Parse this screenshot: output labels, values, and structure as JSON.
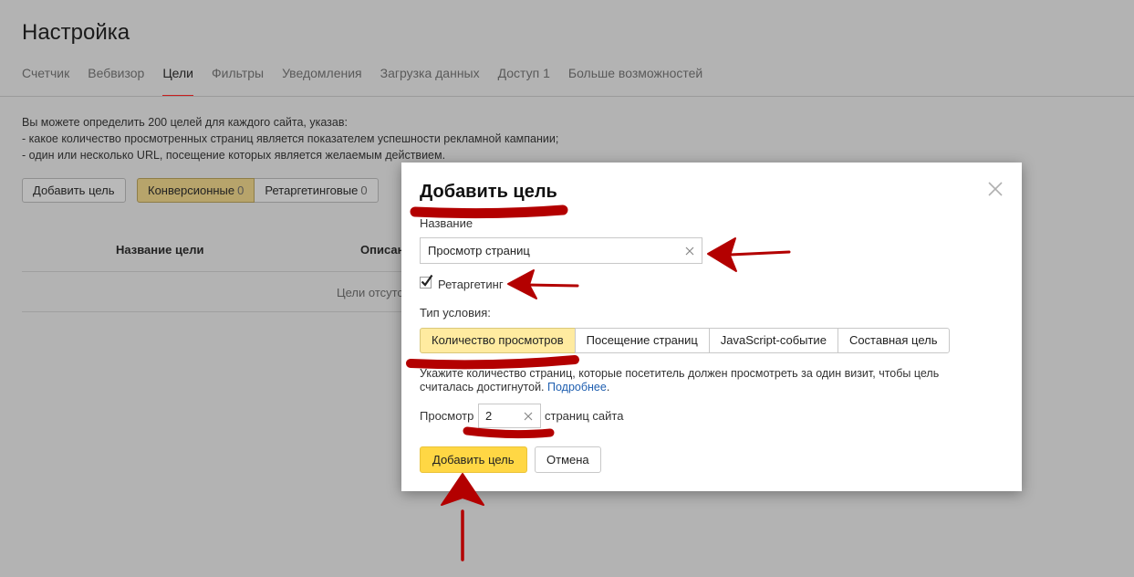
{
  "page": {
    "title": "Настройка",
    "tabs": [
      "Счетчик",
      "Вебвизор",
      "Цели",
      "Фильтры",
      "Уведомления",
      "Загрузка данных",
      "Доступ 1",
      "Больше возможностей"
    ],
    "active_tab": "Цели",
    "intro_lines": [
      "Вы можете определить 200 целей для каждого сайта, указав:",
      "-  какое количество просмотренных страниц является показателем успешности рекламной кампании;",
      "-  один или несколько URL, посещение которых является желаемым действием."
    ],
    "add_goal_label": "Добавить цель",
    "filters": [
      {
        "label": "Конверсионные",
        "count": "0"
      },
      {
        "label": "Ретаргетинговые",
        "count": "0"
      }
    ],
    "table_headers": [
      "Название цели",
      "Описан"
    ],
    "empty_text": "Цели отсутст"
  },
  "modal": {
    "title": "Добавить цель",
    "name_label": "Название",
    "name_value": "Просмотр страниц",
    "retargeting_label": "Ретаргетинг",
    "retargeting_checked": true,
    "condition_label": "Тип условия:",
    "condition_types": [
      "Количество просмотров",
      "Посещение страниц",
      "JavaScript-событие",
      "Составная цель"
    ],
    "selected_condition": "Количество просмотров",
    "hint_text": "Укажите количество страниц, которые посетитель должен просмотреть за один визит, чтобы цель считалась достигнутой.",
    "hint_link": "Подробнее",
    "views_prefix": "Просмотр",
    "views_value": "2",
    "views_suffix": "страниц сайта",
    "submit_label": "Добавить цель",
    "cancel_label": "Отмена"
  },
  "annotations_color": "#b30000",
  "icons": [
    "close-icon",
    "clear-icon",
    "checkmark-icon",
    "arrow-icon"
  ]
}
